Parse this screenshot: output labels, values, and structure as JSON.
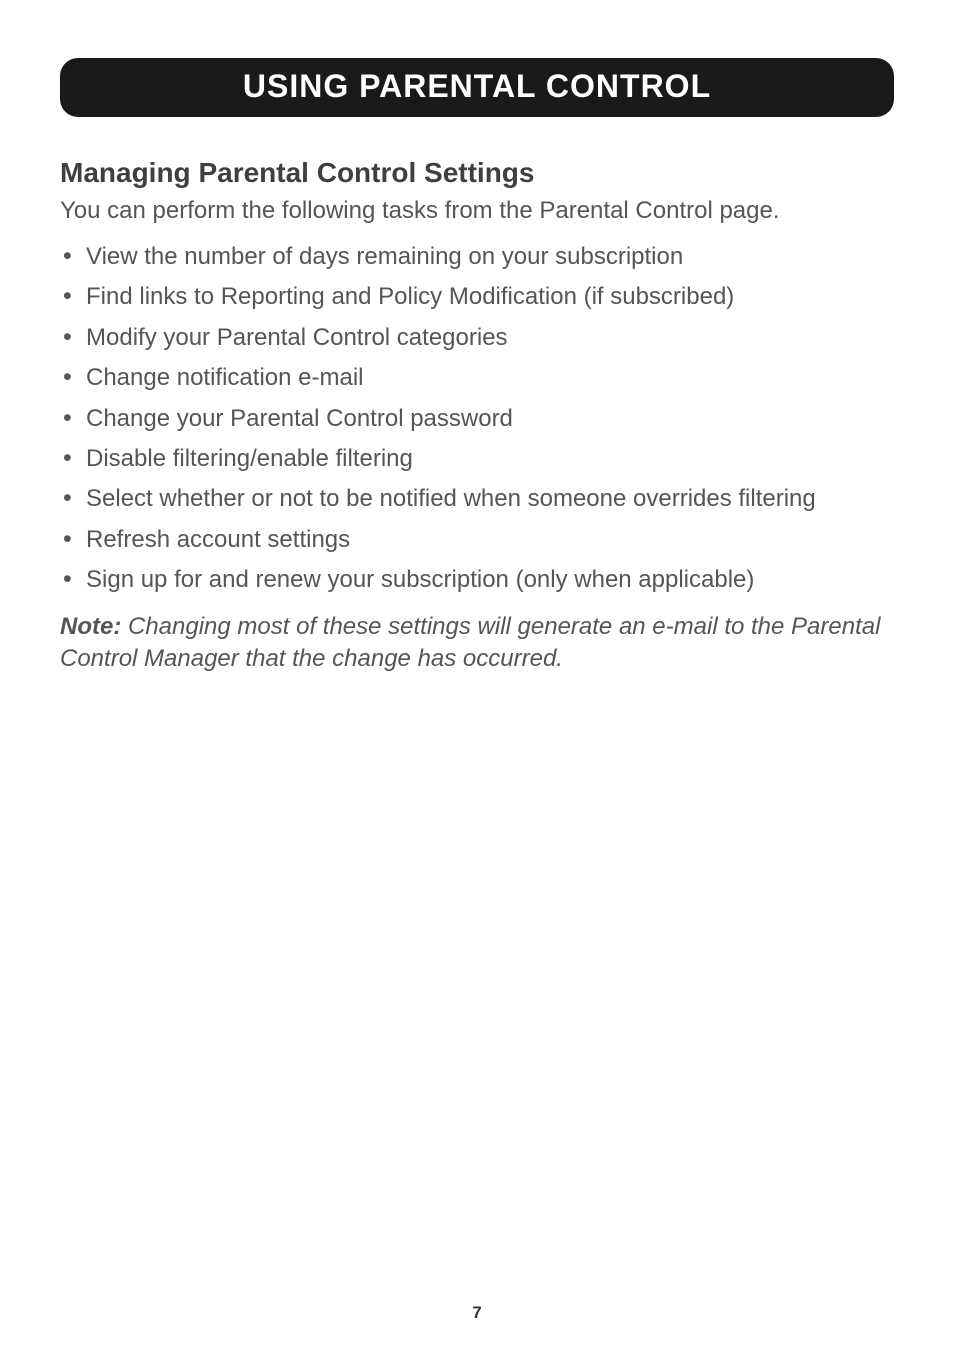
{
  "header": {
    "title": "USING PARENTAL CONTROL"
  },
  "section": {
    "heading": "Managing Parental Control Settings",
    "intro": "You can perform the following tasks from the Parental Control page.",
    "bullets": [
      "View the number of days remaining on your subscription",
      "Find links to Reporting and Policy Modification (if subscribed)",
      "Modify your Parental Control categories",
      "Change notification e-mail",
      "Change your Parental Control password",
      "Disable filtering/enable filtering",
      "Select whether or not to be notified when someone overrides filtering",
      "Refresh account settings",
      "Sign up for and renew your subscription (only when applicable)"
    ],
    "note_label": "Note:",
    "note_body": " Changing most of these settings will generate an e-mail to the Parental Control Manager that the change has occurred."
  },
  "page_number": "7"
}
